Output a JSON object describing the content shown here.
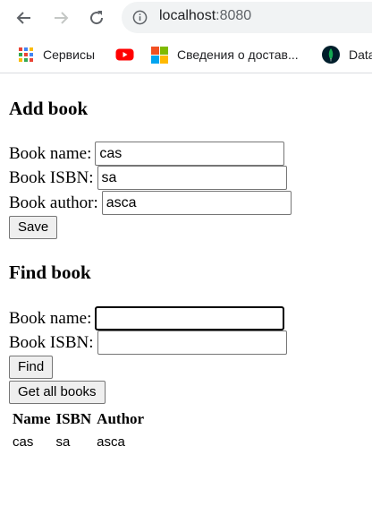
{
  "browser": {
    "url_host": "localhost",
    "url_port": ":8080",
    "bookmarks": [
      {
        "label": "Сервисы",
        "icon": "apps-grid-icon"
      },
      {
        "label": "",
        "icon": "youtube-icon"
      },
      {
        "label": "Сведения о достав...",
        "icon": "microsoft-icon"
      },
      {
        "label": "Data",
        "icon": "mongodb-leaf-icon"
      }
    ]
  },
  "add_book": {
    "heading": "Add book",
    "name_label": "Book name:",
    "name_value": "cas",
    "isbn_label": "Book ISBN:",
    "isbn_value": "sa",
    "author_label": "Book author:",
    "author_value": "asca",
    "save_label": "Save"
  },
  "find_book": {
    "heading": "Find book",
    "name_label": "Book name:",
    "name_value": "",
    "isbn_label": "Book ISBN:",
    "isbn_value": "",
    "find_label": "Find",
    "get_all_label": "Get all books"
  },
  "books_table": {
    "headers": [
      "Name",
      "ISBN",
      "Author"
    ],
    "rows": [
      [
        "cas",
        "sa",
        "asca"
      ]
    ]
  },
  "colors": {
    "omnibox_bg": "#f1f3f4",
    "button_bg": "#efefef",
    "youtube_red": "#ff0000",
    "mongodb_green": "#13aa52"
  }
}
